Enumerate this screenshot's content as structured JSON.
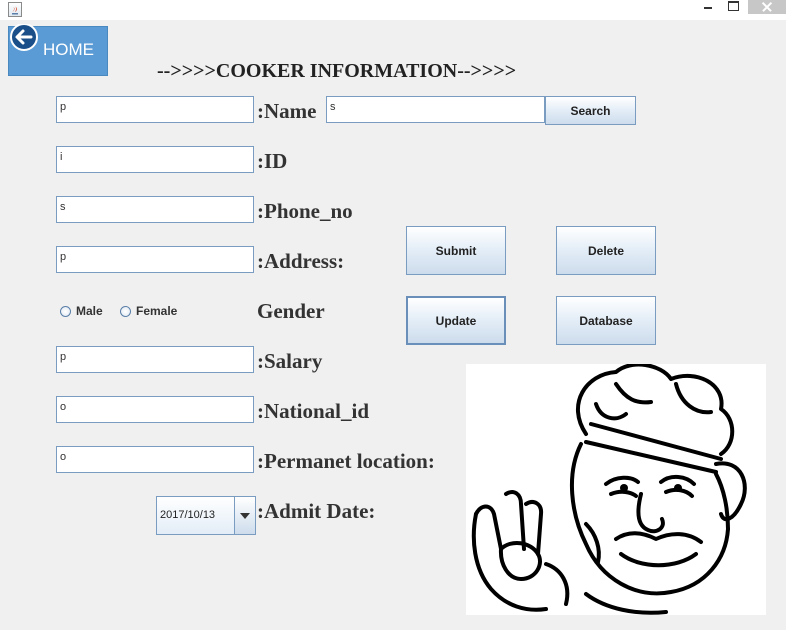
{
  "window": {
    "icon": "java-app-icon"
  },
  "home_button": {
    "label": "HOME",
    "icon": "back-arrow-icon"
  },
  "title": "-->>>>COOKER INFORMATION-->>>>",
  "fields": {
    "name": {
      "value": "p",
      "label": ":Name"
    },
    "id": {
      "value": "i",
      "label": ":ID"
    },
    "phone": {
      "value": "s",
      "label": ":Phone_no"
    },
    "address": {
      "value": "p",
      "label": ":Address:"
    },
    "gender": {
      "label": "Gender",
      "options": [
        "Male",
        "Female"
      ]
    },
    "salary": {
      "value": "p",
      "label": ":Salary"
    },
    "national_id": {
      "value": "o",
      "label": ":National_id"
    },
    "location": {
      "value": "o",
      "label": ":Permanet location:"
    },
    "admit_date": {
      "value": "2017/10/13",
      "label": ":Admit Date:"
    }
  },
  "search": {
    "value": "s",
    "button": "Search"
  },
  "buttons": {
    "submit": "Submit",
    "delete": "Delete",
    "update": "Update",
    "database": "Database"
  },
  "colors": {
    "home_bg": "#5b9bd5",
    "field_border": "#7a9cc0",
    "window_bg": "#f0f0f0"
  }
}
